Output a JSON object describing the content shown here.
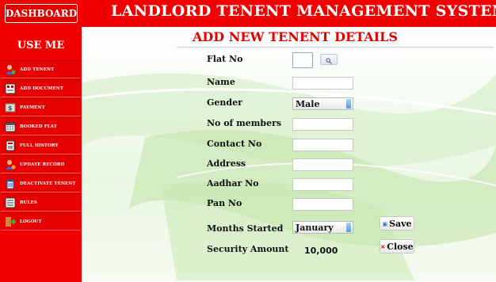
{
  "header": {
    "dashboard_label": "DASHBOARD",
    "app_title": "LANDLORD TENENT MANAGEMENT SYSTEM"
  },
  "sidebar": {
    "heading": "USE ME",
    "items": [
      {
        "label": "ADD TENENT",
        "icon": "person-add-icon"
      },
      {
        "label": "ADD DOCUMENT",
        "icon": "document-icon"
      },
      {
        "label": "PAYMENT",
        "icon": "payment-icon"
      },
      {
        "label": "BOOKED FLAT",
        "icon": "calendar-icon"
      },
      {
        "label": "FULL HISTORY",
        "icon": "history-icon"
      },
      {
        "label": "UPDATE RECORD",
        "icon": "user-update-icon"
      },
      {
        "label": "DEACTIVATE TENENT",
        "icon": "trash-icon"
      },
      {
        "label": "RULES",
        "icon": "rules-icon"
      },
      {
        "label": "LOGOUT",
        "icon": "logout-icon"
      }
    ]
  },
  "form": {
    "title": "ADD NEW TENENT DETAILS",
    "flat_no": {
      "label": "Flat No",
      "value": ""
    },
    "name": {
      "label": "Name",
      "value": ""
    },
    "gender": {
      "label": "Gender",
      "value": "Male"
    },
    "members": {
      "label": "No of members",
      "value": ""
    },
    "contact": {
      "label": "Contact No",
      "value": ""
    },
    "address": {
      "label": "Address",
      "value": ""
    },
    "aadhar": {
      "label": "Aadhar No",
      "value": ""
    },
    "pan": {
      "label": "Pan No",
      "value": ""
    },
    "months_started": {
      "label": "Months Started",
      "value": "January"
    },
    "security_amount": {
      "label": "Security Amount",
      "value": "10,000"
    },
    "save_label": "Save",
    "close_label": "Close"
  },
  "colors": {
    "accent": "#f00000",
    "title_red": "#e00000"
  }
}
